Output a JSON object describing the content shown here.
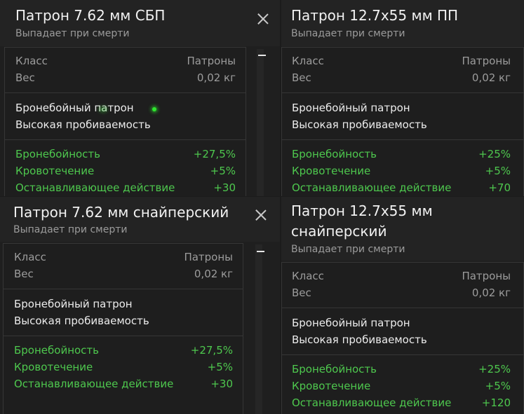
{
  "common": {
    "subtitle": "Выпадает при смерти",
    "class_label": "Класс",
    "class_value": "Патроны",
    "weight_label": "Вес",
    "weight_value": "0,02 кг",
    "desc_line1": "Бронебойный патрон",
    "desc_line2": "Высокая пробиваемость",
    "stat1_label": "Бронебойность",
    "stat2_label": "Кровотечение",
    "stat3_label": "Останавливающее действие"
  },
  "cards": [
    {
      "title": "Патрон 7.62 мм СБП",
      "stat1_value": "+27,5%",
      "stat2_value": "+5%",
      "stat3_value": "+30"
    },
    {
      "title": "Патрон 12.7х55 мм ПП",
      "stat1_value": "+25%",
      "stat2_value": "+5%",
      "stat3_value": "+70"
    },
    {
      "title": "Патрон 7.62 мм снайперский",
      "stat1_value": "+27,5%",
      "stat2_value": "+5%",
      "stat3_value": "+30"
    },
    {
      "title_line1": "Патрон 12.7х55 мм",
      "title_line2": "снайперский",
      "stat1_value": "+25%",
      "stat2_value": "+5%",
      "stat3_value": "+120"
    }
  ],
  "colors": {
    "stat_green": "#4ec84e",
    "cursor_green": "#2fe62f"
  }
}
